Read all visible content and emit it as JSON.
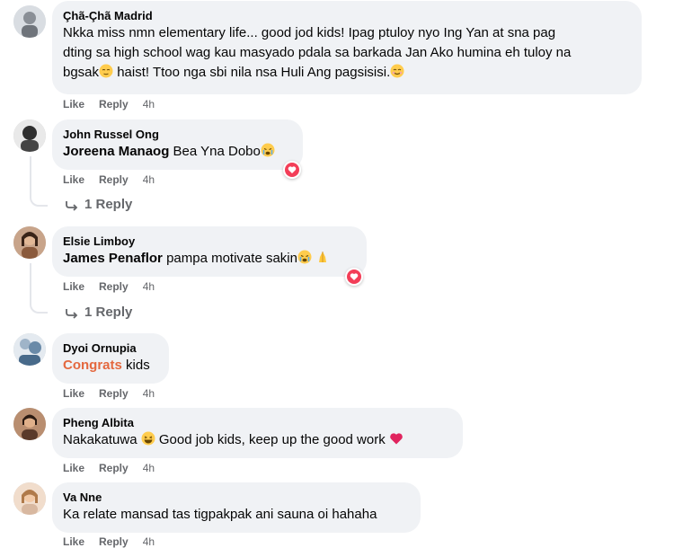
{
  "comments": [
    {
      "author": "Çhã-Çhã Madrid",
      "text_lines": [
        "Nkka miss nmn elementary life... good jod kids! Ipag ptuloy nyo Ing Yan at sna pag",
        "dting sa high school wag kau masyado pdala sa barkada Jan Ako humina eh tuloy na",
        "bgsak",
        "haist! Ttoo nga sbi nila nsa Huli Ang pagsisisi."
      ],
      "like": "Like",
      "reply": "Reply",
      "time": "4h"
    },
    {
      "author": "John Russel Ong",
      "mention": "Joreena Manaog",
      "text": "Bea Yna Dobo",
      "like": "Like",
      "reply": "Reply",
      "time": "4h",
      "replies_label": "1 Reply"
    },
    {
      "author": "Elsie Limboy",
      "mention": "James Penaflor",
      "text": "pampa motivate sakin",
      "like": "Like",
      "reply": "Reply",
      "time": "4h",
      "replies_label": "1 Reply"
    },
    {
      "author": "Dyoi Ornupia",
      "tag": "Congrats",
      "text": "kids",
      "like": "Like",
      "reply": "Reply",
      "time": "4h"
    },
    {
      "author": "Pheng Albita",
      "text_a": "Nakakatuwa",
      "text_b": "Good job kids, keep up the good work",
      "like": "Like",
      "reply": "Reply",
      "time": "4h"
    },
    {
      "author": "Va Nne",
      "text": "Ka relate mansad tas tigpakpak ani sauna oi hahaha",
      "like": "Like",
      "reply": "Reply",
      "time": "4h"
    }
  ],
  "icons": {
    "heart_reaction": "heart-icon",
    "reply_arrow": "reply-arrow-icon"
  },
  "colors": {
    "bubble": "#f0f2f5",
    "meta": "#65676b",
    "tag": "#e4683f",
    "heart": "#f33e58"
  }
}
